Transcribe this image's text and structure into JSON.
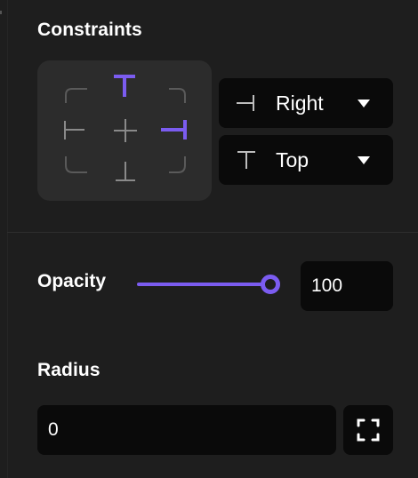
{
  "constraints": {
    "title": "Constraints",
    "horizontal": {
      "label": "Right",
      "icon": "align-right-constraint-icon"
    },
    "vertical": {
      "label": "Top",
      "icon": "align-top-constraint-icon"
    },
    "active_edges": [
      "top",
      "right"
    ],
    "accent_color": "#7b5cf0"
  },
  "opacity": {
    "label": "Opacity",
    "value": "100",
    "slider_fraction": 1.0
  },
  "radius": {
    "label": "Radius",
    "value": "0",
    "toggle_icon": "independent-corners-icon"
  }
}
